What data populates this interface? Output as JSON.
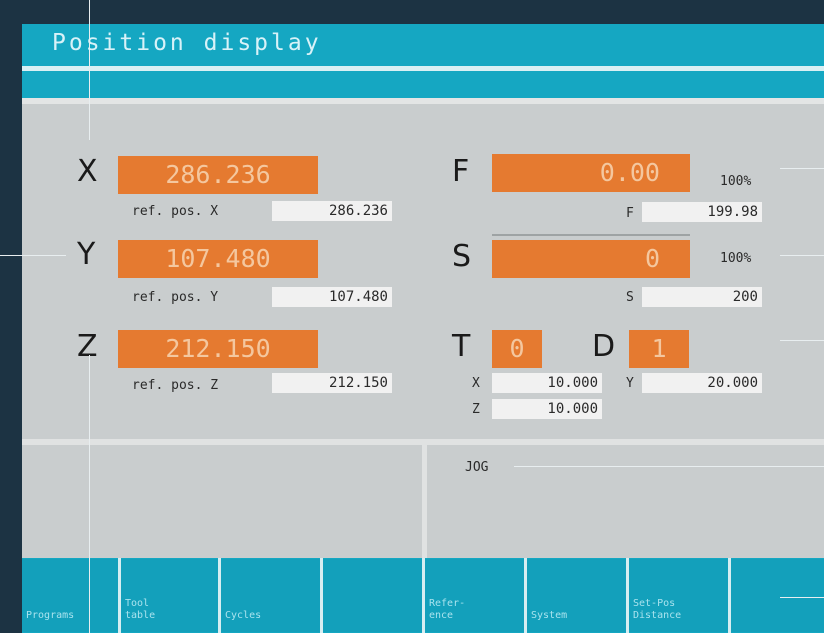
{
  "title": "Position display",
  "axes": [
    {
      "letter": "X",
      "value": "286.236",
      "ref_label": "ref. pos. X",
      "ref_value": "286.236"
    },
    {
      "letter": "Y",
      "value": "107.480",
      "ref_label": "ref. pos. Y",
      "ref_value": "107.480"
    },
    {
      "letter": "Z",
      "value": "212.150",
      "ref_label": "ref. pos. Z",
      "ref_value": "212.150"
    }
  ],
  "feed": {
    "letter": "F",
    "value": "0.00",
    "override": "100%",
    "sub_label": "F",
    "sub_value": "199.98"
  },
  "spindle": {
    "letter": "S",
    "value": "0",
    "override": "100%",
    "sub_label": "S",
    "sub_value": "200"
  },
  "tool": {
    "t_letter": "T",
    "t_value": "0",
    "d_letter": "D",
    "d_value": "1",
    "x_label": "X",
    "x_value": "10.000",
    "y_label": "Y",
    "y_value": "20.000",
    "z_label": "Z",
    "z_value": "10.000"
  },
  "mode": "JOG",
  "softkeys": [
    "Programs",
    "Tool\ntable",
    "Cycles",
    "",
    "Refer-\nence",
    "System",
    "Set-Pos\nDistance",
    ""
  ],
  "colors": {
    "accent": "#15a7c2",
    "value_box": "#e57a30",
    "background": "#c9cdce"
  }
}
